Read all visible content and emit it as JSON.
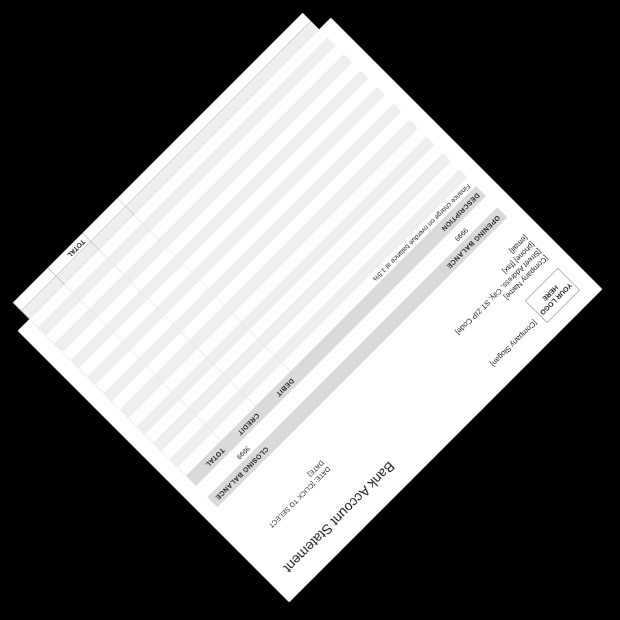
{
  "header": {
    "logo_line1": "YOUR LOGO",
    "logo_line2": "HERE",
    "slogan": "[Company Slogan]",
    "title": "Bank Account Statement",
    "company_name": "[Company Name]",
    "street": "[Street Address, City, ST ZIP Code]",
    "phone_fax": "[phone] [fax]",
    "email": "[email]",
    "date_label": "DATE: [CLICK TO SELECT",
    "date_label_cont": "DATE]"
  },
  "balances": {
    "opening_label": "OPENING BALANCE",
    "closing_label": "CLOSING BALANCE",
    "opening_value": "9999",
    "closing_value": "9999"
  },
  "table": {
    "headers": [
      "DESCRIPTION",
      "DEBIT",
      "CREDIT",
      "TOTAL"
    ],
    "rows": [
      [
        "Finance charge on overdue balance at 1.5%",
        "",
        "",
        ""
      ],
      [
        "",
        "",
        "",
        ""
      ],
      [
        "",
        "",
        "",
        ""
      ],
      [
        "",
        "",
        "",
        ""
      ],
      [
        "",
        "",
        "",
        ""
      ],
      [
        "",
        "",
        "",
        ""
      ],
      [
        "",
        "",
        "",
        ""
      ],
      [
        "",
        "",
        "",
        ""
      ],
      [
        "",
        "",
        "",
        ""
      ],
      [
        "",
        "",
        "",
        ""
      ],
      [
        "",
        "",
        "",
        ""
      ],
      [
        "",
        "",
        "",
        ""
      ],
      [
        "",
        "",
        "",
        ""
      ],
      [
        "",
        "",
        "",
        ""
      ],
      [
        "",
        "",
        "",
        ""
      ],
      [
        "",
        "",
        "",
        ""
      ],
      [
        "",
        "",
        "",
        ""
      ],
      [
        "",
        "",
        "",
        ""
      ],
      [
        "",
        "",
        "",
        ""
      ],
      [
        "",
        "",
        "",
        ""
      ]
    ],
    "total_label": "TOTAL"
  }
}
